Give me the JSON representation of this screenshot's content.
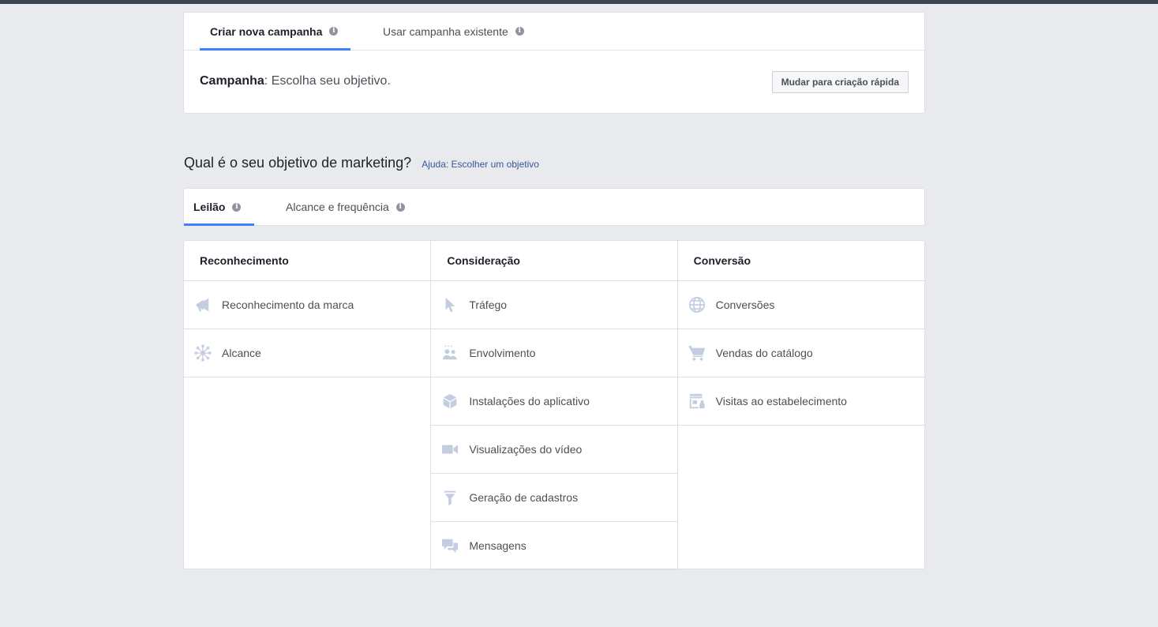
{
  "campaign_tabs": {
    "create_new": "Criar nova campanha",
    "use_existing": "Usar campanha existente"
  },
  "campaign": {
    "label": "Campanha",
    "text": ": Escolha seu objetivo.",
    "quick_button": "Mudar para criação rápida"
  },
  "question": {
    "title": "Qual é o seu objetivo de marketing?",
    "help_link": "Ajuda: Escolher um objetivo"
  },
  "buy_tabs": {
    "auction": "Leilão",
    "reach_frequency": "Alcance e frequência"
  },
  "columns": {
    "awareness": {
      "title": "Reconhecimento",
      "items": [
        "Reconhecimento da marca",
        "Alcance"
      ]
    },
    "consideration": {
      "title": "Consideração",
      "items": [
        "Tráfego",
        "Envolvimento",
        "Instalações do aplicativo",
        "Visualizações do vídeo",
        "Geração de cadastros",
        "Mensagens"
      ]
    },
    "conversion": {
      "title": "Conversão",
      "items": [
        "Conversões",
        "Vendas do catálogo",
        "Visitas ao estabelecimento"
      ]
    }
  },
  "icons": {
    "info": "info-icon",
    "brand_awareness": "megaphone-icon",
    "reach": "reach-icon",
    "traffic": "cursor-icon",
    "engagement": "people-icon",
    "app_installs": "box-icon",
    "video_views": "video-camera-icon",
    "lead_generation": "funnel-icon",
    "messages": "chat-bubbles-icon",
    "conversions": "globe-icon",
    "catalog_sales": "cart-icon",
    "store_visits": "store-icon"
  },
  "colors": {
    "accent": "#4080ff",
    "link": "#365899",
    "icon": "#c4cde0",
    "background": "#e9eaed"
  }
}
